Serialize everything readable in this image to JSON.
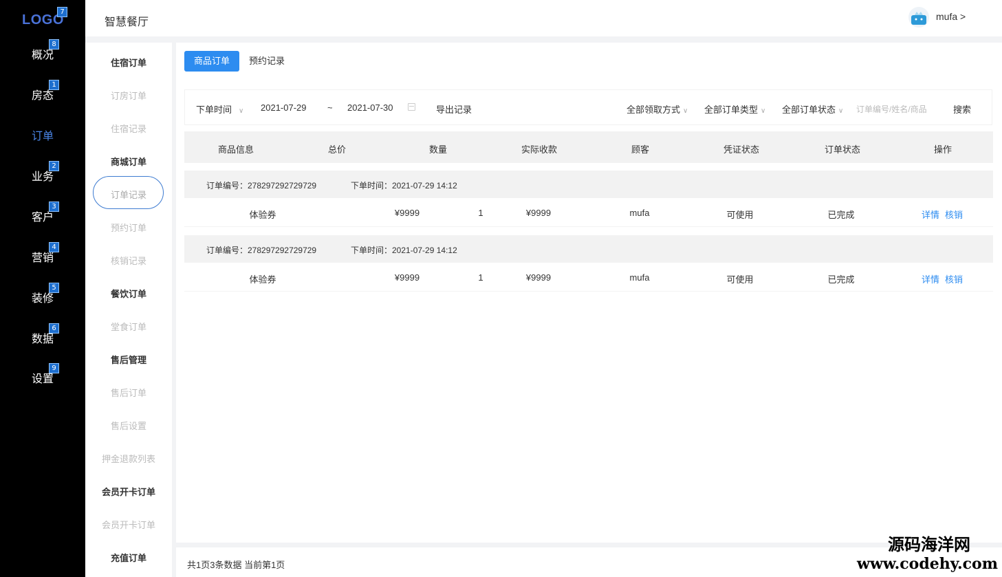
{
  "brand": {
    "logo": "LOGO",
    "logo_badge": "7"
  },
  "nav": [
    {
      "label": "概况",
      "badge": "8"
    },
    {
      "label": "房态",
      "badge": "1"
    },
    {
      "label": "订单",
      "badge": ""
    },
    {
      "label": "业务",
      "badge": "2"
    },
    {
      "label": "客户",
      "badge": "3"
    },
    {
      "label": "营销",
      "badge": "4"
    },
    {
      "label": "装修",
      "badge": "5"
    },
    {
      "label": "数据",
      "badge": "6"
    },
    {
      "label": "设置",
      "badge": "9"
    }
  ],
  "header": {
    "title": "智慧餐厅",
    "user": "mufa >"
  },
  "subnav": [
    {
      "label": "住宿订单"
    },
    {
      "label": "订房订单"
    },
    {
      "label": "住宿记录"
    },
    {
      "label": "商城订单"
    },
    {
      "label": "订单记录"
    },
    {
      "label": "预约订单"
    },
    {
      "label": "核销记录"
    },
    {
      "label": "餐饮订单"
    },
    {
      "label": "堂食订单"
    },
    {
      "label": "售后管理"
    },
    {
      "label": "售后订单"
    },
    {
      "label": "售后设置"
    },
    {
      "label": "押金退款列表"
    },
    {
      "label": "会员开卡订单"
    },
    {
      "label": "会员开卡订单"
    },
    {
      "label": "充值订单"
    }
  ],
  "tabs": [
    {
      "label": "商品订单"
    },
    {
      "label": "预约记录"
    }
  ],
  "filters": {
    "time_type": "下单时间",
    "start_date": "2021-07-29",
    "separator": "~",
    "end_date": "2021-07-30",
    "export_label": "导出记录",
    "pickup": "全部领取方式",
    "order_type": "全部订单类型",
    "order_status": "全部订单状态",
    "search_placeholder": "订单编号/姓名/商品",
    "search_label": "搜索"
  },
  "table": {
    "columns": [
      "商品信息",
      "总价",
      "数量",
      "实际收款",
      "顾客",
      "凭证状态",
      "订单状态",
      "操作"
    ],
    "orders": [
      {
        "order_no": "订单编号：278297292729729",
        "order_time": "下单时间：2021-07-29  14:12",
        "product": "体验券",
        "total": "¥9999",
        "qty": "1",
        "paid": "¥9999",
        "customer": "mufa",
        "voucher_status": "可使用",
        "status": "已完成",
        "action_detail": "详情",
        "action_verify": "核销"
      },
      {
        "order_no": "订单编号：278297292729729",
        "order_time": "下单时间：2021-07-29  14:12",
        "product": "体验券",
        "total": "¥9999",
        "qty": "1",
        "paid": "¥9999",
        "customer": "mufa",
        "voucher_status": "可使用",
        "status": "已完成",
        "action_detail": "详情",
        "action_verify": "核销"
      }
    ]
  },
  "footer": {
    "summary": "共1页3条数据 当前第1页"
  },
  "watermark": {
    "line1": "源码海洋网",
    "line2": "www.codehy.com"
  }
}
